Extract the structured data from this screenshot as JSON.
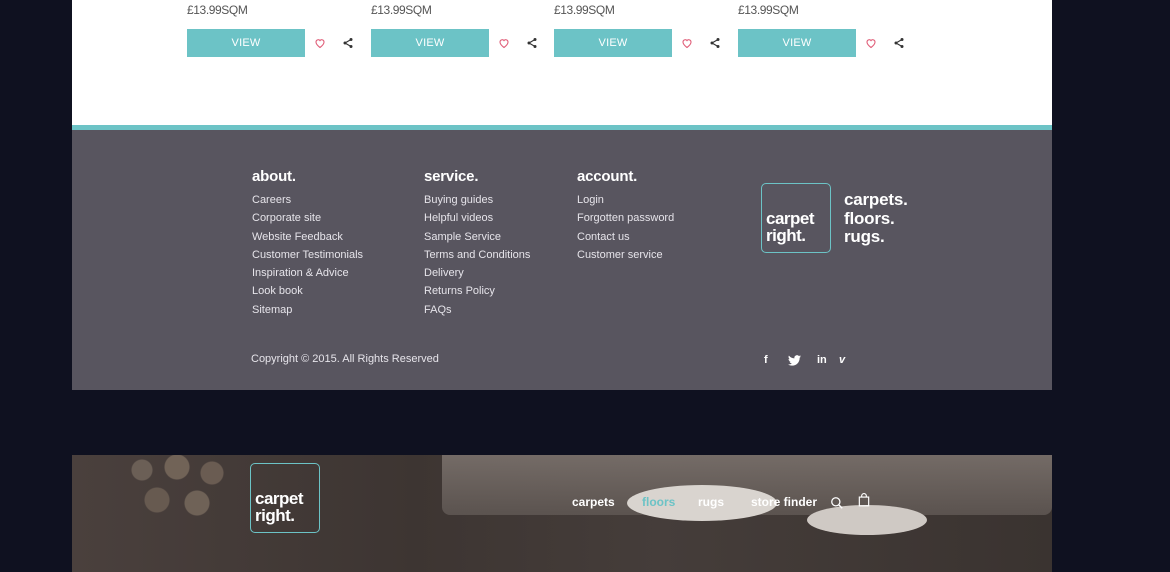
{
  "products": [
    {
      "price": "£13.99SQM",
      "button_label": "VIEW"
    },
    {
      "price": "£13.99SQM",
      "button_label": "VIEW"
    },
    {
      "price": "£13.99SQM",
      "button_label": "VIEW"
    },
    {
      "price": "£13.99SQM",
      "button_label": "VIEW"
    }
  ],
  "footer": {
    "about": {
      "title": "about.",
      "links": [
        "Careers",
        "Corporate site",
        "Website Feedback",
        "Customer Testimonials",
        "Inspiration & Advice",
        "Look book",
        "Sitemap"
      ]
    },
    "service": {
      "title": "service.",
      "links": [
        "Buying guides",
        "Helpful videos",
        "Sample Service",
        "Terms and Conditions",
        "Delivery",
        "Returns Policy",
        "FAQs"
      ]
    },
    "account": {
      "title": "account.",
      "links": [
        "Login",
        "Forgotten password",
        "Contact us",
        "Customer service"
      ]
    },
    "logo": {
      "line1": "carpet",
      "line2": "right."
    },
    "tagline": [
      "carpets.",
      "floors.",
      "rugs."
    ],
    "copyright": "Copyright © 2015. All Rights Reserved",
    "social": [
      {
        "icon": "facebook-icon",
        "glyph": "f"
      },
      {
        "icon": "twitter-icon",
        "glyph": "t"
      },
      {
        "icon": "linkedin-icon",
        "glyph": "in"
      },
      {
        "icon": "vimeo-icon",
        "glyph": "v"
      }
    ]
  },
  "hero": {
    "logo": {
      "line1": "carpet",
      "line2": "right."
    },
    "nav": [
      {
        "label": "carpets",
        "active": false
      },
      {
        "label": "floors",
        "active": true
      },
      {
        "label": "rugs",
        "active": false
      },
      {
        "label": "store finder",
        "active": false
      }
    ]
  },
  "colors": {
    "accent": "#6cc3c6",
    "footer_bg": "#58555f",
    "page_bg": "#0f1120",
    "heart": "#e0607a"
  }
}
